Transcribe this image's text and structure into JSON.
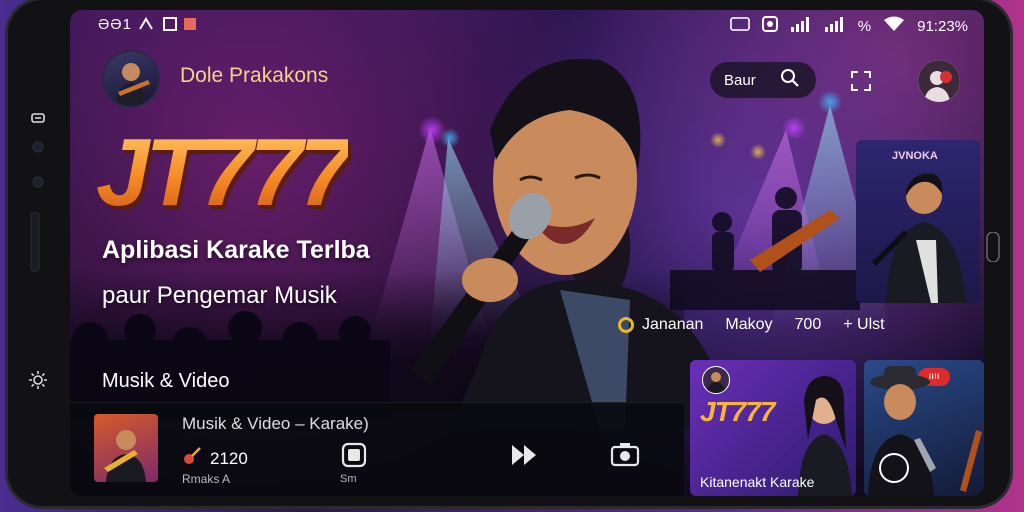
{
  "status_bar": {
    "left_text": "ƏƏ1",
    "time": "91:23%",
    "percent": "%"
  },
  "header": {
    "channel_name": "Dole Prakakons",
    "search_label": "Baur"
  },
  "hero": {
    "brand": "JT777",
    "tagline_line1": "Aplibasi Karake Terlba",
    "tagline_line2": "paur Pengemar Musik"
  },
  "meta": {
    "artist": "Jananan",
    "artist2": "Makoy",
    "count": "700",
    "add_label": "+ Ulst"
  },
  "side_thumb": {
    "title": "JVNOKA"
  },
  "section": {
    "label": "Musik & Video"
  },
  "player": {
    "title": "Musik & Video – Karake)",
    "stat_value": "2120",
    "sub_label": "Rmaks A",
    "ctl_label": "Sm"
  },
  "cards": [
    {
      "logo": "JT777",
      "caption": "Kitanenakt Karake"
    },
    {
      "badge": "ıııı"
    }
  ],
  "colors": {
    "brand_orange": "#f58a22",
    "channel_gold": "#f2d38a",
    "accent_purple": "#6a2fb8"
  }
}
